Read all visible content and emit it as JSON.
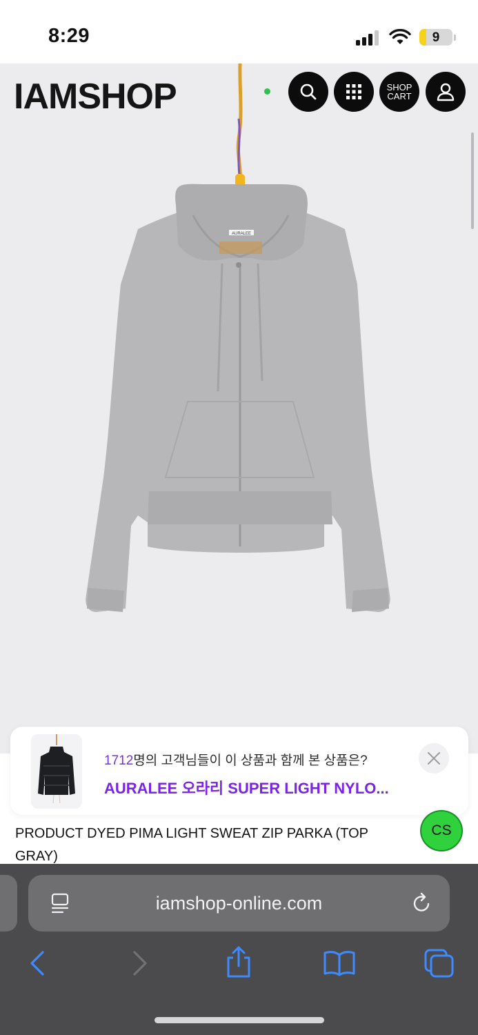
{
  "status_bar": {
    "time": "8:29",
    "battery_level": "9",
    "icons": [
      "signal-icon",
      "wifi-icon",
      "battery-icon"
    ]
  },
  "header": {
    "logo": "IAMSHOP",
    "search_icon": "search-icon",
    "menu_icon": "grid-icon",
    "cart_line1": "SHOP",
    "cart_line2": "CART",
    "account_icon": "user-icon"
  },
  "product_image": {
    "hanger_tag": "AURALEE"
  },
  "recommendation": {
    "count": "1712",
    "text": "명의 고객님들이 이 상품과 함께 본 상품은?",
    "product": "AURALEE 오라리 SUPER LIGHT NYLO...",
    "close_icon": "close-icon"
  },
  "product": {
    "name": "PRODUCT DYED PIMA LIGHT SWEAT ZIP PARKA (TOP GRAY)"
  },
  "cs_button": {
    "label": "CS",
    "color": "#2fd23d"
  },
  "browser": {
    "url": "iamshop-online.com",
    "icons": [
      "reader-icon",
      "reload-icon",
      "back-icon",
      "forward-icon",
      "share-icon",
      "bookmarks-icon",
      "tabs-icon"
    ]
  },
  "colors": {
    "accent_purple": "#7b23e6",
    "nav_button": "#0c0c0c",
    "browser_bar": "#4b4b4d",
    "toolbar_icon_blue": "#3d8bff"
  }
}
